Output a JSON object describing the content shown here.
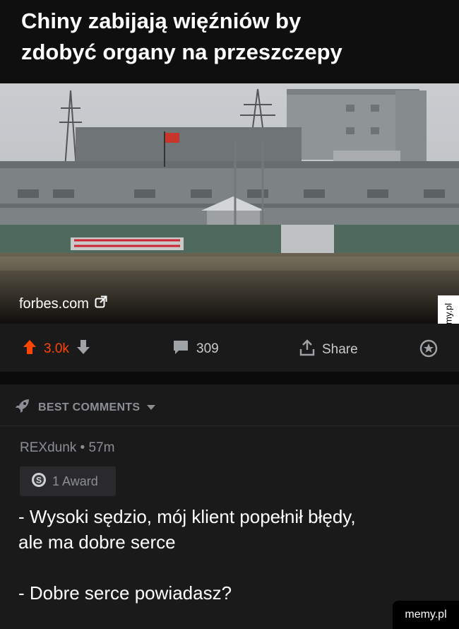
{
  "post": {
    "title_line1": "Chiny zabijają więźniów by",
    "title_line2": "zdobyć organy na przeszczepy",
    "source": "forbes.com"
  },
  "actions": {
    "upvotes": "3.0k",
    "comments": "309",
    "share": "Share"
  },
  "comments_header": {
    "label": "BEST COMMENTS"
  },
  "comment": {
    "user_meta": "REXdunk • 57m",
    "award": "1 Award",
    "line1": "- Wysoki sędzio, mój klient popełnił błędy,",
    "line2": "ale ma dobre serce",
    "line3": "- Dobre serce powiadasz?"
  },
  "watermarks": {
    "side": "memy.pl",
    "corner": "memy.pl"
  },
  "colors": {
    "upvote": "#ff4500",
    "background": "#1a1a1b"
  },
  "icons": [
    "external-link-icon",
    "upvote-icon",
    "downvote-icon",
    "comment-icon",
    "share-icon",
    "award-icon",
    "rocket-icon",
    "caret-down-icon",
    "silver-award-icon"
  ]
}
